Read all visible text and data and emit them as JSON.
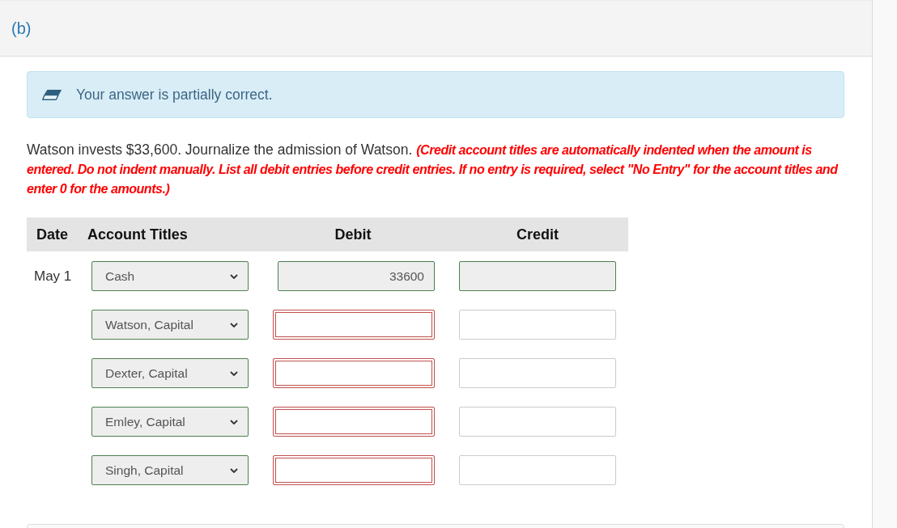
{
  "part": {
    "label": "(b)"
  },
  "feedback": {
    "kind": "partial",
    "message": "Your answer is partially correct."
  },
  "question": {
    "text": "Watson invests $33,600. Journalize the admission of Watson.",
    "instruction": "(Credit account titles are automatically indented when the amount is entered. Do not indent manually. List all debit entries before credit entries. If no entry is required, select \"No Entry\" for the account titles and enter 0 for the amounts.)"
  },
  "journal": {
    "columns": [
      "Date",
      "Account Titles",
      "Debit",
      "Credit"
    ],
    "rows": [
      {
        "date": "May 1",
        "account": {
          "value": "Cash",
          "correct": true,
          "incorrect": false
        },
        "debit": {
          "value": "33600",
          "correct": true,
          "incorrect": false
        },
        "credit": {
          "correct": true,
          "incorrect": false
        }
      },
      {
        "account": {
          "value": "Watson, Capital",
          "correct": true,
          "incorrect": false
        },
        "debit": {
          "correct": false,
          "incorrect": true
        },
        "credit": {
          "correct": false,
          "incorrect": false
        }
      },
      {
        "account": {
          "value": "Dexter, Capital",
          "correct": true,
          "incorrect": false
        },
        "debit": {
          "correct": false,
          "incorrect": true
        },
        "credit": {
          "correct": false,
          "incorrect": false
        }
      },
      {
        "account": {
          "value": "Emley, Capital",
          "correct": true,
          "incorrect": false
        },
        "debit": {
          "correct": false,
          "incorrect": true
        },
        "credit": {
          "correct": false,
          "incorrect": false
        }
      },
      {
        "account": {
          "value": "Singh, Capital",
          "correct": true,
          "incorrect": false
        },
        "debit": {
          "correct": false,
          "incorrect": true
        },
        "credit": {
          "correct": false,
          "incorrect": false
        }
      }
    ]
  }
}
